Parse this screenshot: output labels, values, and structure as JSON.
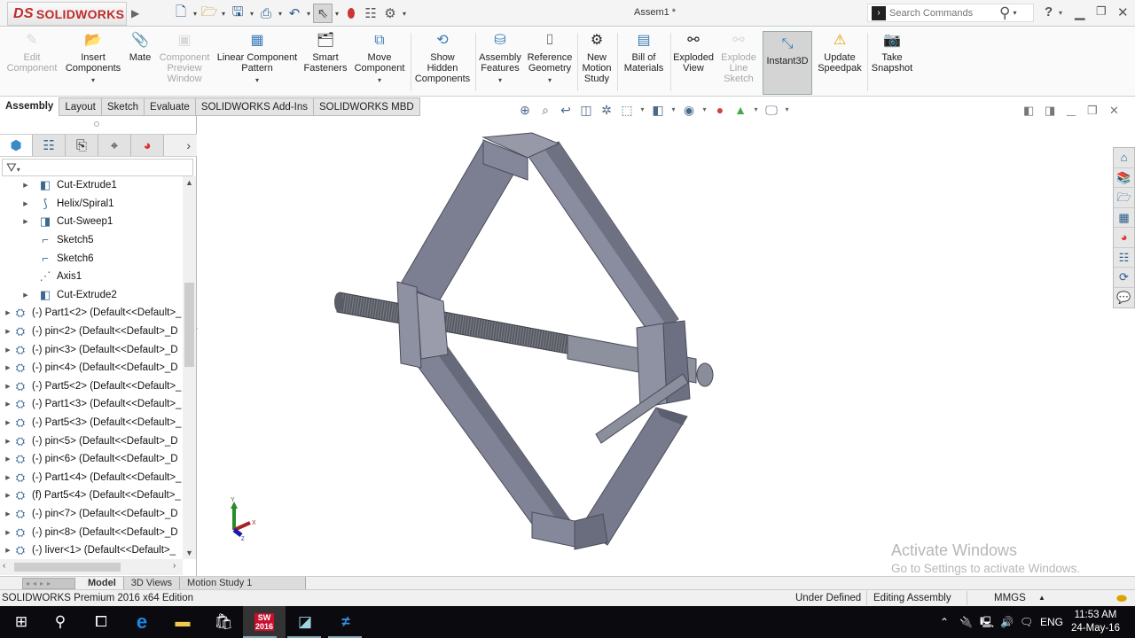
{
  "app": {
    "brand": "SOLIDWORKS",
    "brand_prefix": "DS",
    "document_title": "Assem1 *"
  },
  "quick_access": [
    {
      "name": "new-document",
      "icon": "□"
    },
    {
      "name": "open",
      "icon": "📂"
    },
    {
      "name": "save",
      "icon": "💾"
    },
    {
      "name": "print",
      "icon": "🖶"
    },
    {
      "name": "undo",
      "icon": "↶"
    },
    {
      "name": "select",
      "icon": "↖"
    },
    {
      "name": "rebuild",
      "icon": "●"
    },
    {
      "name": "file-properties",
      "icon": "☰"
    },
    {
      "name": "options",
      "icon": "⚙"
    }
  ],
  "search": {
    "placeholder": "Search Commands",
    "help": "?"
  },
  "ribbon": {
    "edit_component": "Edit\nComponent",
    "insert_components": "Insert\nComponents",
    "mate": "Mate",
    "component_preview_window": "Component\nPreview\nWindow",
    "linear_component_pattern": "Linear Component\nPattern",
    "smart_fasteners": "Smart\nFasteners",
    "move_component": "Move\nComponent",
    "show_hidden_components": "Show\nHidden\nComponents",
    "assembly_features": "Assembly\nFeatures",
    "reference_geometry": "Reference\nGeometry",
    "new_motion_study": "New\nMotion\nStudy",
    "bill_of_materials": "Bill of\nMaterials",
    "exploded_view": "Exploded\nView",
    "explode_line_sketch": "Explode\nLine\nSketch",
    "instant3d": "Instant3D",
    "update_speedpak": "Update\nSpeedpak",
    "take_snapshot": "Take\nSnapshot"
  },
  "tabs": [
    "Assembly",
    "Layout",
    "Sketch",
    "Evaluate",
    "SOLIDWORKS Add-Ins",
    "SOLIDWORKS MBD"
  ],
  "active_tab": "Assembly",
  "feature_tree": [
    {
      "label": "Cut-Extrude1",
      "icon": "cut-extrude",
      "glyph": "◧",
      "expandable": true,
      "indent": 1
    },
    {
      "label": "Helix/Spiral1",
      "icon": "helix",
      "glyph": "⟆",
      "expandable": true,
      "indent": 1
    },
    {
      "label": "Cut-Sweep1",
      "icon": "cut-sweep",
      "glyph": "◨",
      "expandable": true,
      "indent": 1
    },
    {
      "label": "Sketch5",
      "icon": "sketch",
      "glyph": "⌐",
      "expandable": false,
      "indent": 1
    },
    {
      "label": "Sketch6",
      "icon": "sketch",
      "glyph": "⌐",
      "expandable": false,
      "indent": 1
    },
    {
      "label": "Axis1",
      "icon": "axis",
      "glyph": "⋰",
      "expandable": false,
      "indent": 1
    },
    {
      "label": "Cut-Extrude2",
      "icon": "cut-extrude",
      "glyph": "◧",
      "expandable": true,
      "indent": 1
    },
    {
      "label": "(-) Part1<2> (Default<<Default>_",
      "icon": "part",
      "glyph": "⛭",
      "expandable": true,
      "indent": 0
    },
    {
      "label": "(-) pin<2> (Default<<Default>_D",
      "icon": "part",
      "glyph": "⛭",
      "expandable": true,
      "indent": 0
    },
    {
      "label": "(-) pin<3> (Default<<Default>_D",
      "icon": "part",
      "glyph": "⛭",
      "expandable": true,
      "indent": 0
    },
    {
      "label": "(-) pin<4> (Default<<Default>_D",
      "icon": "part",
      "glyph": "⛭",
      "expandable": true,
      "indent": 0
    },
    {
      "label": "(-) Part5<2> (Default<<Default>_",
      "icon": "part",
      "glyph": "⛭",
      "expandable": true,
      "indent": 0
    },
    {
      "label": "(-) Part1<3> (Default<<Default>_",
      "icon": "part",
      "glyph": "⛭",
      "expandable": true,
      "indent": 0
    },
    {
      "label": "(-) Part5<3> (Default<<Default>_",
      "icon": "part",
      "glyph": "⛭",
      "expandable": true,
      "indent": 0
    },
    {
      "label": "(-) pin<5> (Default<<Default>_D",
      "icon": "part",
      "glyph": "⛭",
      "expandable": true,
      "indent": 0
    },
    {
      "label": "(-) pin<6> (Default<<Default>_D",
      "icon": "part",
      "glyph": "⛭",
      "expandable": true,
      "indent": 0
    },
    {
      "label": "(-) Part1<4> (Default<<Default>_",
      "icon": "part",
      "glyph": "⛭",
      "expandable": true,
      "indent": 0
    },
    {
      "label": "(f) Part5<4> (Default<<Default>_",
      "icon": "part",
      "glyph": "⛭",
      "expandable": true,
      "indent": 0
    },
    {
      "label": "(-) pin<7> (Default<<Default>_D",
      "icon": "part",
      "glyph": "⛭",
      "expandable": true,
      "indent": 0
    },
    {
      "label": "(-) pin<8> (Default<<Default>_D",
      "icon": "part",
      "glyph": "⛭",
      "expandable": true,
      "indent": 0
    },
    {
      "label": "(-) liver<1> (Default<<Default>_",
      "icon": "part",
      "glyph": "⛭",
      "expandable": true,
      "indent": 0
    }
  ],
  "bottom_tabs": [
    "Model",
    "3D Views",
    "Motion Study 1"
  ],
  "active_bottom_tab": "Model",
  "status_bar": {
    "edition": "SOLIDWORKS Premium 2016 x64 Edition",
    "definition": "Under Defined",
    "mode": "Editing Assembly",
    "units": "MMGS"
  },
  "watermark": {
    "title": "Activate Windows",
    "subtitle": "Go to Settings to activate Windows."
  },
  "triad": {
    "y": "Y",
    "x": "X",
    "z": "Z"
  },
  "taskbar": {
    "language": "ENG",
    "time": "11:53 AM",
    "date": "24-May-16",
    "sw_badge": "SW\n2016"
  }
}
